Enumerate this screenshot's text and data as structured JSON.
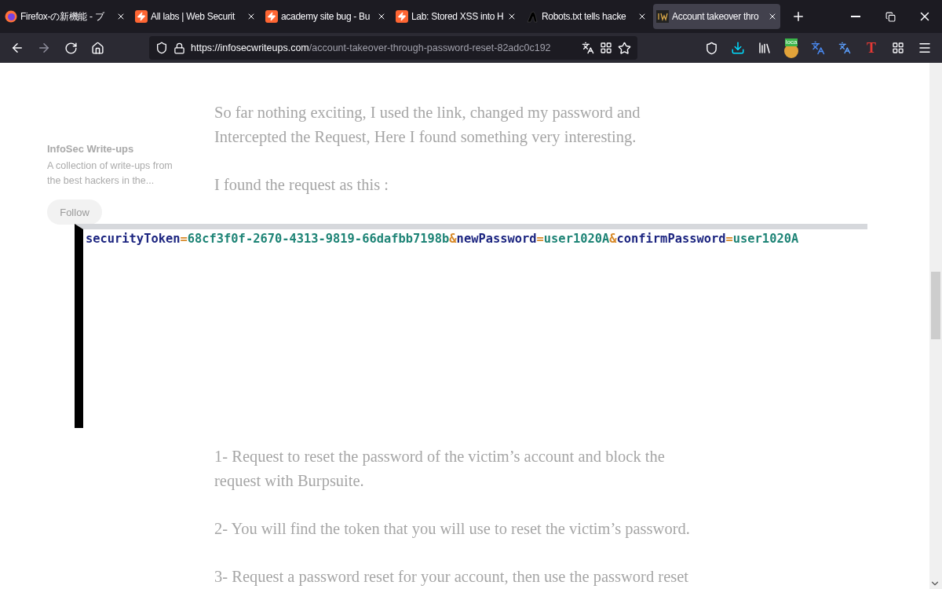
{
  "tabs": [
    {
      "label": "Firefox-の新機能 - ブ",
      "selected": false
    },
    {
      "label": "All labs | Web Securit",
      "selected": false
    },
    {
      "label": "academy site bug - Bu",
      "selected": false
    },
    {
      "label": "Lab: Stored XSS into H",
      "selected": false
    },
    {
      "label": "Robots.txt tells hacke",
      "selected": false
    },
    {
      "label": "Account takeover thro",
      "selected": true
    }
  ],
  "toolbar": {
    "back_disabled": false,
    "forward_disabled": true,
    "url_host": "https://infosecwriteups.com",
    "url_path": "/account-takeover-through-password-reset-82adc0c192"
  },
  "extensions": [
    {
      "kind": "loca",
      "label": "loca"
    },
    {
      "kind": "translate"
    },
    {
      "kind": "translate2"
    },
    {
      "kind": "t",
      "label": "T"
    },
    {
      "kind": "grid"
    }
  ],
  "sidebar": {
    "publication": "InfoSec Write-ups",
    "description": [
      "A collection of write-ups from",
      "the best hackers in the..."
    ],
    "follow": "Follow"
  },
  "article": {
    "paragraphs": [
      {
        "lines": [
          "So far nothing exciting, I used the link, changed my password and",
          "Intercepted the Request, Here I found something very interesting."
        ]
      },
      {
        "lines": [
          "I found the request as this :"
        ]
      },
      {
        "kind": "gap"
      },
      {
        "lines": [
          "1- Request to reset the password of the victim’s account and block the",
          "request with Burpsuite."
        ]
      },
      {
        "lines": [
          "2- You will find the token that you will use to reset the victim’s password."
        ]
      },
      {
        "lines": [
          "3- Request a password reset for your account, then use the password reset"
        ]
      }
    ]
  },
  "image": {
    "segments": [
      {
        "kind": "key",
        "text": "securityToken"
      },
      {
        "kind": "op",
        "text": "="
      },
      {
        "kind": "value",
        "text": "68cf3f0f-2670-4313-9819-66dafbb7198b"
      },
      {
        "kind": "op",
        "text": "&"
      },
      {
        "kind": "key",
        "text": "newPassword"
      },
      {
        "kind": "op",
        "text": "="
      },
      {
        "kind": "value",
        "text": "user1020A"
      },
      {
        "kind": "op",
        "text": "&"
      },
      {
        "kind": "key",
        "text": "confirmPassword"
      },
      {
        "kind": "op",
        "text": "="
      },
      {
        "kind": "value",
        "text": "user1020A"
      }
    ]
  }
}
